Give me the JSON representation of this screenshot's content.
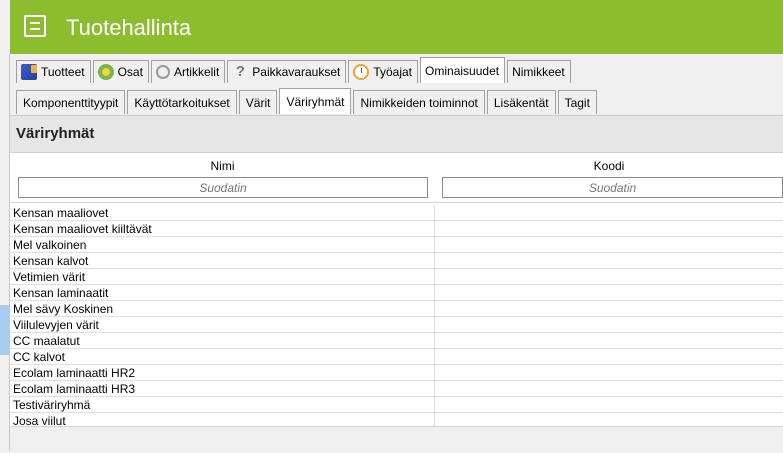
{
  "app": {
    "title": "Tuotehallinta",
    "icon": "clipboard-list-icon",
    "accent_color": "#8cbd2f"
  },
  "main_tabs": [
    {
      "label": "Tuotteet",
      "icon": "box-icon",
      "active": false
    },
    {
      "label": "Osat",
      "icon": "parts-icon",
      "active": false
    },
    {
      "label": "Artikkelit",
      "icon": "circle-icon",
      "active": false
    },
    {
      "label": "Paikkavaraukset",
      "icon": "question-icon",
      "active": false
    },
    {
      "label": "Työajat",
      "icon": "stopwatch-icon",
      "active": false
    },
    {
      "label": "Ominaisuudet",
      "icon": "",
      "active": true
    },
    {
      "label": "Nimikkeet",
      "icon": "",
      "active": false
    }
  ],
  "sub_tabs": [
    {
      "label": "Komponenttityypit",
      "active": false
    },
    {
      "label": "Käyttötarkoitukset",
      "active": false
    },
    {
      "label": "Värit",
      "active": false
    },
    {
      "label": "Väriryhmät",
      "active": true
    },
    {
      "label": "Nimikkeiden toiminnot",
      "active": false
    },
    {
      "label": "Lisäkentät",
      "active": false
    },
    {
      "label": "Tagit",
      "active": false
    }
  ],
  "section": {
    "title": "Väriryhmät"
  },
  "table": {
    "columns": [
      {
        "header": "Nimi",
        "filter_placeholder": "Suodatin"
      },
      {
        "header": "Koodi",
        "filter_placeholder": "Suodatin"
      }
    ],
    "rows": [
      [
        "Kensan maaliovet",
        ""
      ],
      [
        "Kensan maaliovet kiiltävät",
        ""
      ],
      [
        "Mel valkoinen",
        ""
      ],
      [
        "Kensan kalvot",
        ""
      ],
      [
        "Vetimien värit",
        ""
      ],
      [
        "Kensan laminaatit",
        ""
      ],
      [
        "Mel sävy Koskinen",
        ""
      ],
      [
        "Viilulevyjen värit",
        ""
      ],
      [
        "CC maalatut",
        ""
      ],
      [
        "CC kalvot",
        ""
      ],
      [
        "Ecolam laminaatti HR2",
        ""
      ],
      [
        "Ecolam laminaatti HR3",
        ""
      ],
      [
        "Testiväriryhmä",
        ""
      ],
      [
        "Josa viilut",
        ""
      ]
    ]
  }
}
